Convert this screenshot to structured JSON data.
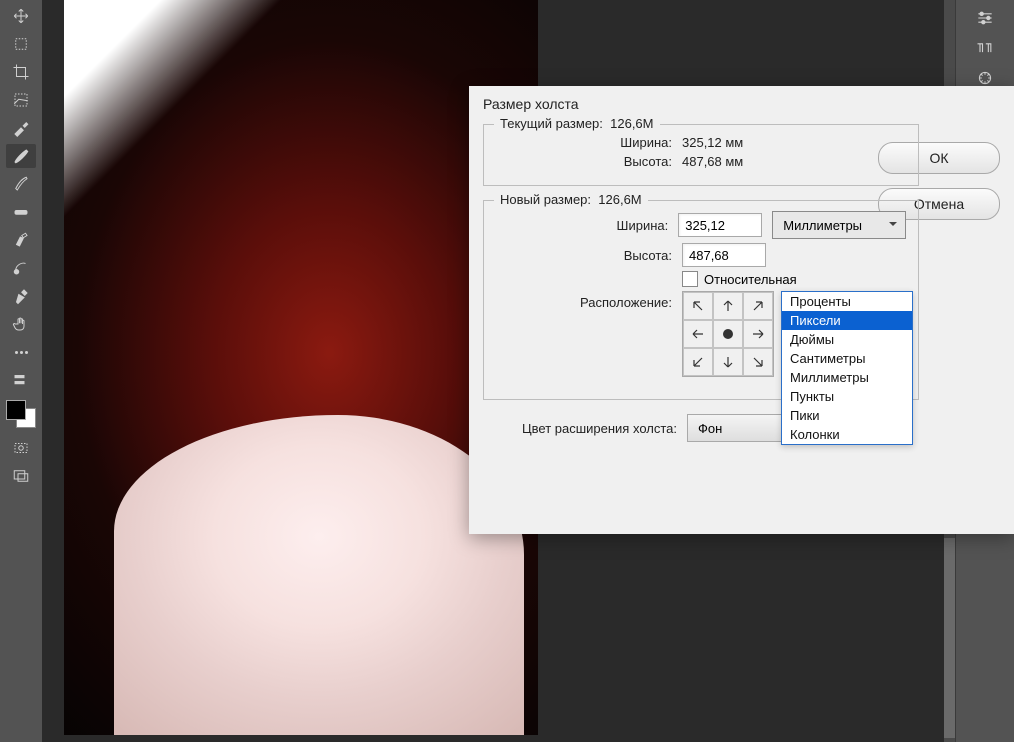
{
  "dialog": {
    "title": "Размер холста",
    "current": {
      "legend": "Текущий размер:",
      "size": "126,6M",
      "width_label": "Ширина:",
      "width_value": "325,12 мм",
      "height_label": "Высота:",
      "height_value": "487,68 мм"
    },
    "new": {
      "legend": "Новый размер:",
      "size": "126,6M",
      "width_label": "Ширина:",
      "width_value": "325,12",
      "height_label": "Высота:",
      "height_value": "487,68",
      "units_selected": "Миллиметры",
      "relative_label": "Относительная",
      "anchor_label": "Расположение:"
    },
    "extension": {
      "label": "Цвет расширения холста:",
      "value": "Фон"
    },
    "buttons": {
      "ok": "ОК",
      "cancel": "Отмена"
    },
    "units_options": [
      "Проценты",
      "Пиксели",
      "Дюймы",
      "Сантиметры",
      "Миллиметры",
      "Пункты",
      "Пики",
      "Колонки"
    ],
    "units_highlight": "Пиксели"
  },
  "tools": [
    "move",
    "artboard",
    "crop",
    "slice",
    "eyedropper",
    "brush",
    "clone",
    "pattern",
    "eraser",
    "gradient",
    "pen",
    "hand"
  ],
  "right_panels": [
    "adjustments",
    "paragraph",
    "navigator"
  ]
}
